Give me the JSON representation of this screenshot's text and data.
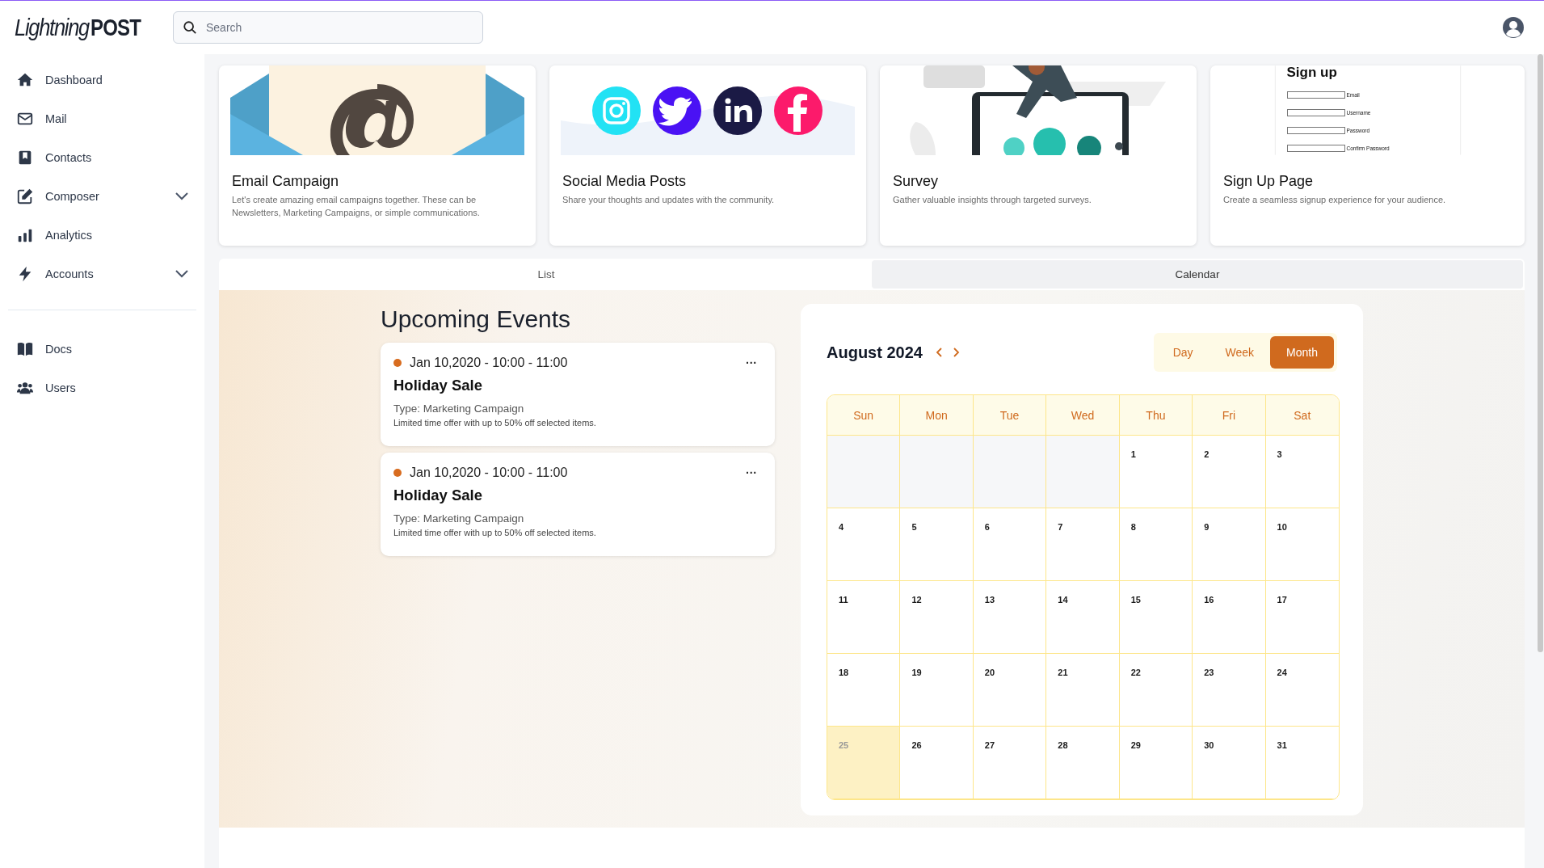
{
  "header": {
    "logo": {
      "text_1": "Lightning",
      "text_2": "POST"
    },
    "search": {
      "placeholder": "Search"
    }
  },
  "sidebar": {
    "items": [
      {
        "label": "Dashboard",
        "kind": "link"
      },
      {
        "label": "Mail",
        "kind": "link"
      },
      {
        "label": "Contacts",
        "kind": "link"
      },
      {
        "label": "Composer",
        "kind": "group"
      },
      {
        "label": "Analytics",
        "kind": "link"
      },
      {
        "label": "Accounts",
        "kind": "group"
      }
    ],
    "footer_items": [
      {
        "label": "Docs"
      },
      {
        "label": "Users"
      }
    ]
  },
  "cards": [
    {
      "kind": "email",
      "title": "Email Campaign",
      "description": "Let's create amazing email campaigns together. These can be Newsletters, Marketing Campaigns, or simple communications."
    },
    {
      "kind": "social",
      "title": "Social Media Posts",
      "description": "Share your thoughts and updates with the community."
    },
    {
      "kind": "survey",
      "title": "Survey",
      "description": "Gather valuable insights through targeted surveys."
    },
    {
      "kind": "signup",
      "title": "Sign Up Page",
      "description": "Create a seamless signup experience for your audience.",
      "preview": {
        "heading": "Sign up",
        "fields": [
          "Email",
          "Username",
          "Password",
          "Confirm Password"
        ]
      }
    }
  ],
  "tabs": [
    {
      "label": "List",
      "selected": false
    },
    {
      "label": "Calendar",
      "selected": true
    }
  ],
  "events": {
    "title": "Upcoming Events",
    "items": [
      {
        "date": "Jan 10,2020 - 10:00 - 11:00",
        "color": "#d86c1f",
        "title": "Holiday Sale",
        "type": "Type: Marketing Campaign",
        "description": "Limited time offer with up to 50% off selected items.",
        "menu": "···"
      },
      {
        "date": "Jan 10,2020 - 10:00 - 11:00",
        "color": "#d86c1f",
        "title": "Holiday Sale",
        "type": "Type: Marketing Campaign",
        "description": "Limited time offer with up to 50% off selected items.",
        "menu": "···"
      }
    ]
  },
  "calendar": {
    "title": "August 2024",
    "views": [
      {
        "label": "Day",
        "selected": false
      },
      {
        "label": "Week",
        "selected": false
      },
      {
        "label": "Month",
        "selected": true
      }
    ],
    "weekdays": [
      "Sun",
      "Mon",
      "Tue",
      "Wed",
      "Thu",
      "Fri",
      "Sat"
    ],
    "days": [
      {
        "kind": "blank"
      },
      {
        "kind": "blank"
      },
      {
        "kind": "blank"
      },
      {
        "kind": "blank"
      },
      {
        "kind": "day",
        "label": "1",
        "selected": false
      },
      {
        "kind": "day",
        "label": "2",
        "selected": false
      },
      {
        "kind": "day",
        "label": "3",
        "selected": false
      },
      {
        "kind": "day",
        "label": "4",
        "selected": false
      },
      {
        "kind": "day",
        "label": "5",
        "selected": false
      },
      {
        "kind": "day",
        "label": "6",
        "selected": false
      },
      {
        "kind": "day",
        "label": "7",
        "selected": false
      },
      {
        "kind": "day",
        "label": "8",
        "selected": false
      },
      {
        "kind": "day",
        "label": "9",
        "selected": false
      },
      {
        "kind": "day",
        "label": "10",
        "selected": false
      },
      {
        "kind": "day",
        "label": "11",
        "selected": false
      },
      {
        "kind": "day",
        "label": "12",
        "selected": false
      },
      {
        "kind": "day",
        "label": "13",
        "selected": false
      },
      {
        "kind": "day",
        "label": "14",
        "selected": false
      },
      {
        "kind": "day",
        "label": "15",
        "selected": false
      },
      {
        "kind": "day",
        "label": "16",
        "selected": false
      },
      {
        "kind": "day",
        "label": "17",
        "selected": false
      },
      {
        "kind": "day",
        "label": "18",
        "selected": false
      },
      {
        "kind": "day",
        "label": "19",
        "selected": false
      },
      {
        "kind": "day",
        "label": "20",
        "selected": false
      },
      {
        "kind": "day",
        "label": "21",
        "selected": false
      },
      {
        "kind": "day",
        "label": "22",
        "selected": false
      },
      {
        "kind": "day",
        "label": "23",
        "selected": false
      },
      {
        "kind": "day",
        "label": "24",
        "selected": false
      },
      {
        "kind": "day",
        "label": "25",
        "selected": true
      },
      {
        "kind": "day",
        "label": "26",
        "selected": false
      },
      {
        "kind": "day",
        "label": "27",
        "selected": false
      },
      {
        "kind": "day",
        "label": "28",
        "selected": false
      },
      {
        "kind": "day",
        "label": "29",
        "selected": false
      },
      {
        "kind": "day",
        "label": "30",
        "selected": false
      },
      {
        "kind": "day",
        "label": "31",
        "selected": false
      }
    ]
  }
}
